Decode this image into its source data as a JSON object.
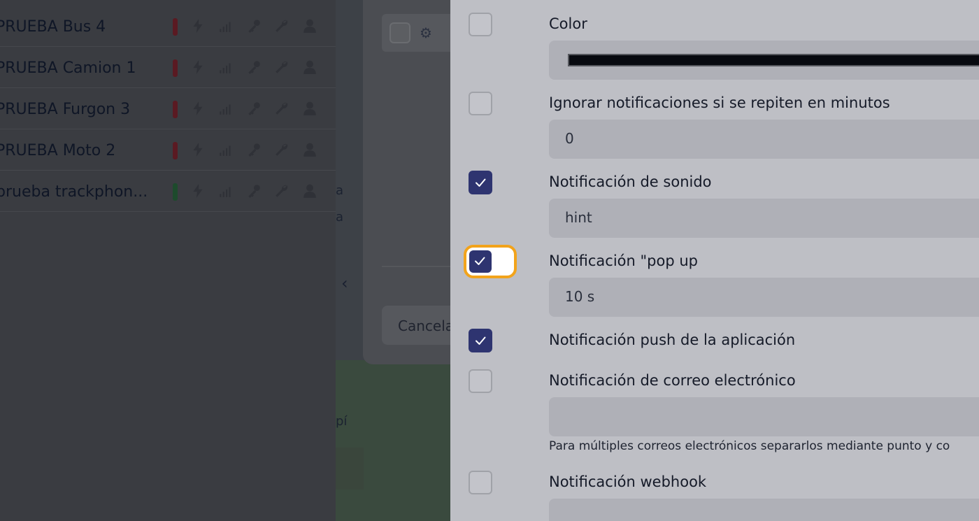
{
  "vehicles": [
    {
      "name": "PRUEBA Bus 4",
      "status_color": "#5a1a22"
    },
    {
      "name": "PRUEBA Camion 1",
      "status_color": "#5a1a22"
    },
    {
      "name": "PRUEBA Furgon 3",
      "status_color": "#5a1a22"
    },
    {
      "name": "PRUEBA Moto 2",
      "status_color": "#5a1a22"
    },
    {
      "name": "prueba trackphon...",
      "status_color": "#1d4a2c"
    }
  ],
  "vehicle_icons": [
    "bolt-icon",
    "signal-icon",
    "key-icon",
    "wrench-icon",
    "user-icon"
  ],
  "map": {
    "text_a": "a",
    "text_pi": "pí"
  },
  "background_modal": {
    "cancel_label": "Cancela"
  },
  "settings": {
    "color": {
      "label": "Color",
      "checked": false,
      "swatch_color": "#080a10"
    },
    "ignore_repeat": {
      "label": "Ignorar notificaciones si se repiten en minutos",
      "checked": false,
      "value": "0"
    },
    "sound": {
      "label": "Notificación de sonido",
      "checked": true,
      "value": "hint"
    },
    "popup": {
      "label": "Notificación \"pop up",
      "checked": true,
      "value": "10 s",
      "focused": true
    },
    "push": {
      "label": "Notificación push de la aplicación",
      "checked": true
    },
    "email": {
      "label": "Notificación de correo electrónico",
      "checked": false,
      "value": "",
      "helper": "Para múltiples correos electrónicos separarlos mediante punto y co"
    },
    "webhook": {
      "label": "Notificación webhook",
      "checked": false,
      "value": ""
    }
  },
  "colors": {
    "accent": "#2e3470",
    "focus_ring": "#f2a31b",
    "panel_bg": "#bebfc5",
    "field_bg": "#afb0b7"
  }
}
